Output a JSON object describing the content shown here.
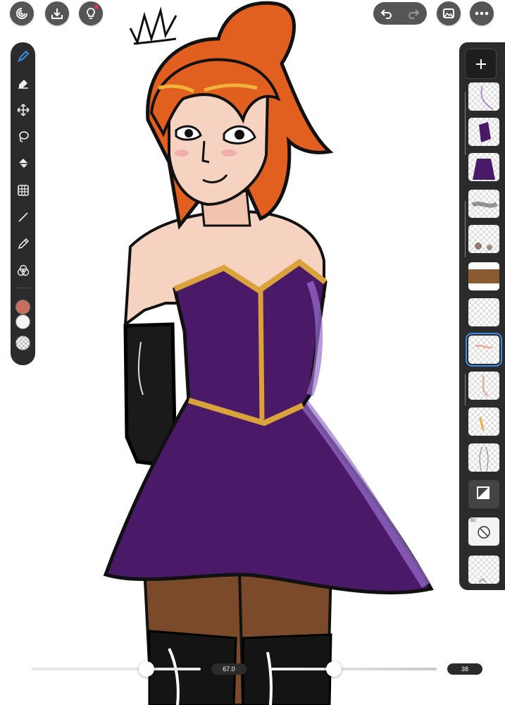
{
  "app": {
    "top_left_buttons": [
      "app-logo-icon",
      "import-icon",
      "tips-lightbulb-icon"
    ],
    "top_right_buttons": [
      "undo-icon",
      "redo-icon",
      "gallery-icon",
      "more-icon"
    ]
  },
  "tools": [
    {
      "name": "brush",
      "icon": "brush-icon",
      "active": true
    },
    {
      "name": "eraser",
      "icon": "eraser-icon"
    },
    {
      "name": "move",
      "icon": "move-icon"
    },
    {
      "name": "lasso",
      "icon": "lasso-icon"
    },
    {
      "name": "fill",
      "icon": "fill-bucket-icon"
    },
    {
      "name": "transform",
      "icon": "transform-grid-icon"
    },
    {
      "name": "line",
      "icon": "line-icon"
    },
    {
      "name": "eyedropper",
      "icon": "eyedropper-icon"
    },
    {
      "name": "blend",
      "icon": "color-blend-icon"
    }
  ],
  "colors": {
    "primary": "#c96f5f",
    "secondary": "#f4f4f4",
    "accent": "#3a8ee6",
    "panel": "#2b2b2b"
  },
  "layers": {
    "count": 12,
    "selected_index": 7,
    "badge_3d": "3D"
  },
  "bottom": {
    "brush_size": "67.0",
    "opacity": "38",
    "size_fraction": 0.68,
    "opacity_fraction": 0.38
  }
}
